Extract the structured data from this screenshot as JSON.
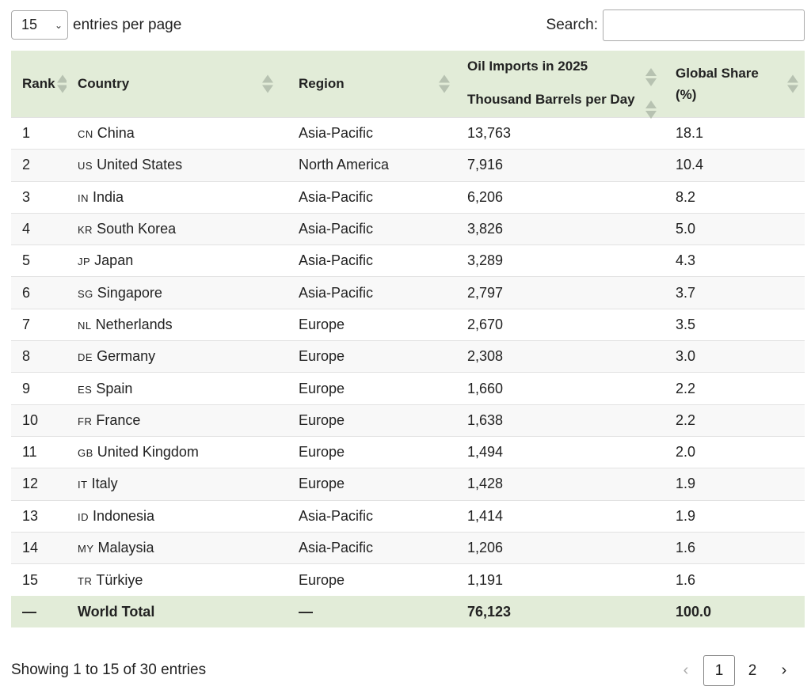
{
  "length_menu": {
    "value": "15",
    "label": "entries per page"
  },
  "search": {
    "label": "Search:",
    "value": "",
    "placeholder": ""
  },
  "table": {
    "headers": {
      "rank": "Rank",
      "country": "Country",
      "region": "Region",
      "imports_line1": "Oil Imports in 2025",
      "imports_line2": "Thousand Barrels per Day",
      "share": "Global Share (%)"
    },
    "rows": [
      {
        "rank": "1",
        "code": "CN",
        "country": "China",
        "region": "Asia-Pacific",
        "imports": "13,763",
        "share": "18.1"
      },
      {
        "rank": "2",
        "code": "US",
        "country": "United States",
        "region": "North America",
        "imports": "7,916",
        "share": "10.4"
      },
      {
        "rank": "3",
        "code": "IN",
        "country": "India",
        "region": "Asia-Pacific",
        "imports": "6,206",
        "share": "8.2"
      },
      {
        "rank": "4",
        "code": "KR",
        "country": "South Korea",
        "region": "Asia-Pacific",
        "imports": "3,826",
        "share": "5.0"
      },
      {
        "rank": "5",
        "code": "JP",
        "country": "Japan",
        "region": "Asia-Pacific",
        "imports": "3,289",
        "share": "4.3"
      },
      {
        "rank": "6",
        "code": "SG",
        "country": "Singapore",
        "region": "Asia-Pacific",
        "imports": "2,797",
        "share": "3.7"
      },
      {
        "rank": "7",
        "code": "NL",
        "country": "Netherlands",
        "region": "Europe",
        "imports": "2,670",
        "share": "3.5"
      },
      {
        "rank": "8",
        "code": "DE",
        "country": "Germany",
        "region": "Europe",
        "imports": "2,308",
        "share": "3.0"
      },
      {
        "rank": "9",
        "code": "ES",
        "country": "Spain",
        "region": "Europe",
        "imports": "1,660",
        "share": "2.2"
      },
      {
        "rank": "10",
        "code": "FR",
        "country": "France",
        "region": "Europe",
        "imports": "1,638",
        "share": "2.2"
      },
      {
        "rank": "11",
        "code": "GB",
        "country": "United Kingdom",
        "region": "Europe",
        "imports": "1,494",
        "share": "2.0"
      },
      {
        "rank": "12",
        "code": "IT",
        "country": "Italy",
        "region": "Europe",
        "imports": "1,428",
        "share": "1.9"
      },
      {
        "rank": "13",
        "code": "ID",
        "country": "Indonesia",
        "region": "Asia-Pacific",
        "imports": "1,414",
        "share": "1.9"
      },
      {
        "rank": "14",
        "code": "MY",
        "country": "Malaysia",
        "region": "Asia-Pacific",
        "imports": "1,206",
        "share": "1.6"
      },
      {
        "rank": "15",
        "code": "TR",
        "country": "Türkiye",
        "region": "Europe",
        "imports": "1,191",
        "share": "1.6"
      }
    ],
    "total": {
      "rank": "—",
      "country": "World Total",
      "region": "—",
      "imports": "76,123",
      "share": "100.0"
    }
  },
  "footer": {
    "info": "Showing 1 to 15 of 30 entries",
    "pagination": {
      "prev": "‹",
      "pages": [
        "1",
        "2"
      ],
      "current": "1",
      "next": "›"
    }
  },
  "colors": {
    "header_bg": "#e2ecd8",
    "sort_icon": "#b7c2b1",
    "row_alt": "#f8f8f8"
  }
}
